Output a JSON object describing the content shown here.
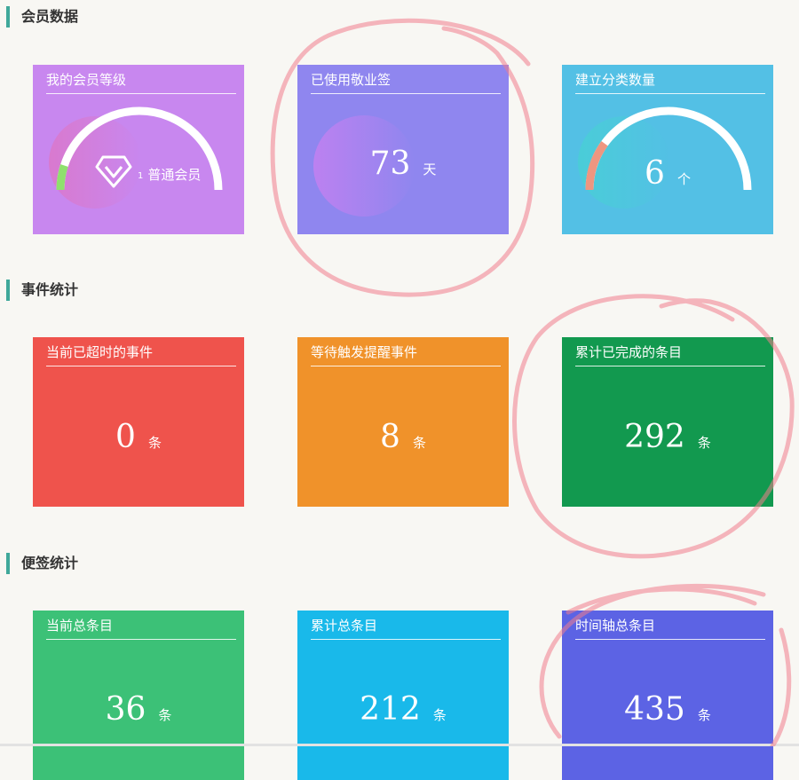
{
  "sections": {
    "member": {
      "title": "会员数据",
      "cards": {
        "level": {
          "title": "我的会员等级",
          "level_num": "1",
          "level_name": "普通会员",
          "color": "#c887ef",
          "gauge_fraction": 0.1
        },
        "days_used": {
          "title": "已使用敬业签",
          "value": "73",
          "unit": "天",
          "color": "#8f86ef"
        },
        "categories": {
          "title": "建立分类数量",
          "value": "6",
          "unit": "个",
          "color": "#53c0e5",
          "gauge_fraction": 0.2
        }
      }
    },
    "events": {
      "title": "事件统计",
      "cards": {
        "overdue": {
          "title": "当前已超时的事件",
          "value": "0",
          "unit": "条",
          "color": "#ef534c"
        },
        "pending": {
          "title": "等待触发提醒事件",
          "value": "8",
          "unit": "条",
          "color": "#f0922a"
        },
        "completed": {
          "title": "累计已完成的条目",
          "value": "292",
          "unit": "条",
          "color": "#12994f"
        }
      }
    },
    "notes": {
      "title": "便签统计",
      "cards": {
        "current_total": {
          "title": "当前总条目",
          "value": "36",
          "unit": "条",
          "color": "#3cc177"
        },
        "accumulated_total": {
          "title": "累计总条目",
          "value": "212",
          "unit": "条",
          "color": "#19b9ea"
        },
        "timeline_total": {
          "title": "时间轴总条目",
          "value": "435",
          "unit": "条",
          "color": "#5c63e4"
        }
      }
    }
  },
  "annotation_color": "#f07e8c"
}
